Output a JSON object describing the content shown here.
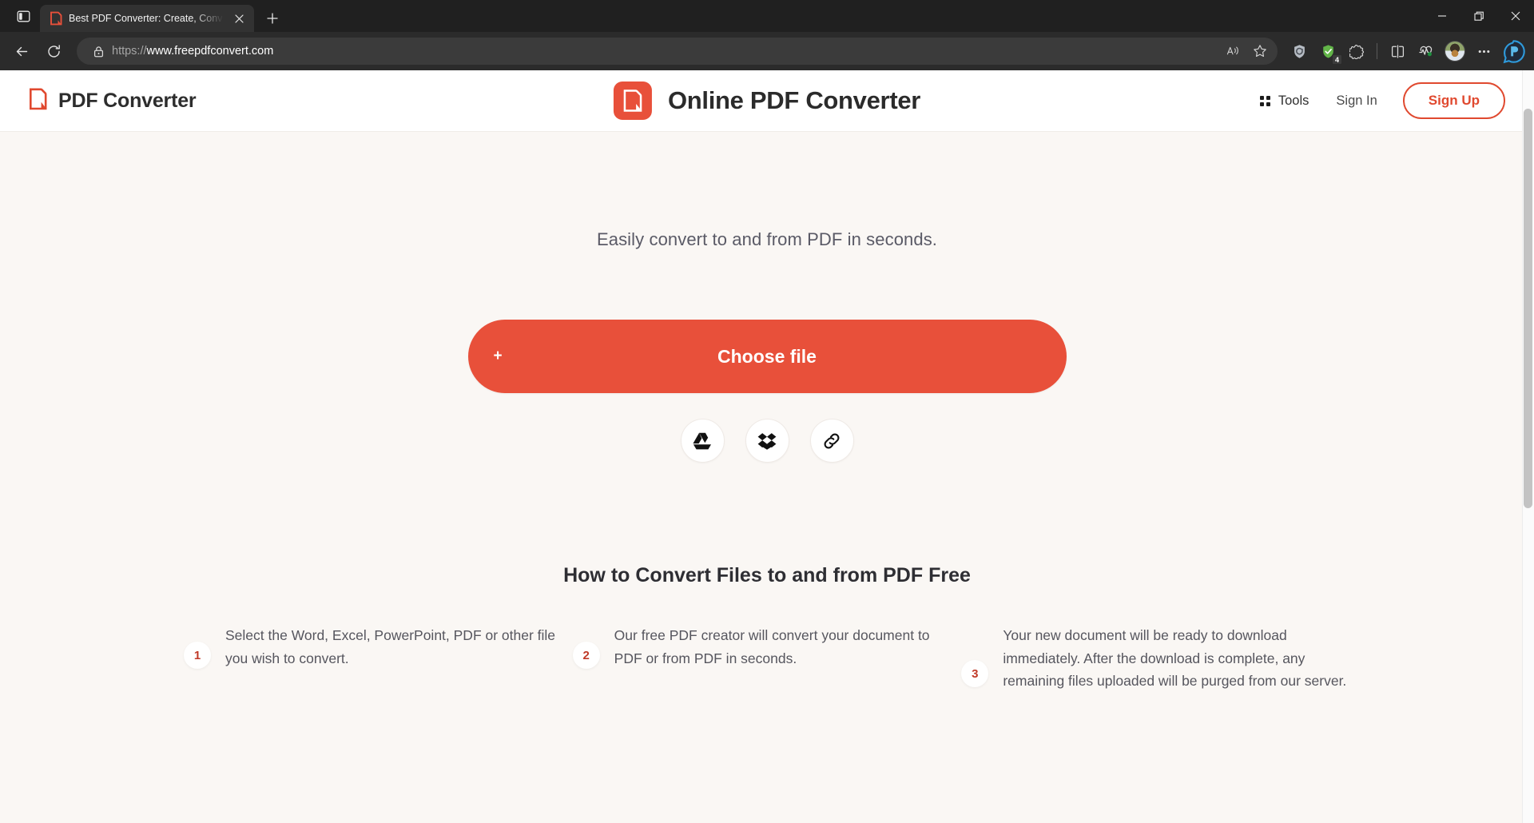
{
  "browser": {
    "tab_sidebar_icon": "split-pane-icon",
    "tab": {
      "favicon": "pdf-converter-favicon",
      "title": "Best PDF Converter: Create, Conv",
      "close_icon": "close-icon"
    },
    "new_tab_label": "+",
    "window_controls": {
      "minimize": "minimize-icon",
      "restore": "restore-icon",
      "close": "close-icon"
    },
    "nav": {
      "back": "back-arrow-icon",
      "reload": "reload-icon"
    },
    "address_bar": {
      "lock_icon": "lock-icon",
      "scheme": "https://",
      "host": "www.freepdfconvert.com",
      "read_aloud_icon": "read-aloud-icon",
      "favorite_icon": "star-icon"
    },
    "toolbar_icons": [
      {
        "name": "shield-icon",
        "badge": ""
      },
      {
        "name": "adguard-icon",
        "badge": "4"
      },
      {
        "name": "extensions-puzzle-icon",
        "badge": ""
      },
      {
        "name": "split-screen-icon",
        "badge": ""
      },
      {
        "name": "browser-essentials-icon",
        "badge": ""
      },
      {
        "name": "profile-avatar",
        "badge": ""
      },
      {
        "name": "settings-more-icon",
        "badge": ""
      },
      {
        "name": "copilot-icon",
        "badge": ""
      }
    ]
  },
  "site": {
    "brand_name": "PDF Converter",
    "center_title": "Online PDF Converter",
    "nav": {
      "tools_label": "Tools",
      "signin_label": "Sign In",
      "signup_label": "Sign Up"
    },
    "hero": {
      "tagline": "Easily convert to and from PDF in seconds.",
      "choose_file_label": "Choose file",
      "plus_symbol": "+",
      "services": [
        {
          "name": "google-drive-icon",
          "label": "Google Drive"
        },
        {
          "name": "dropbox-icon",
          "label": "Dropbox"
        },
        {
          "name": "url-link-icon",
          "label": "From URL"
        }
      ]
    },
    "howto": {
      "title": "How to Convert Files to and from PDF Free",
      "steps": [
        {
          "num": "1",
          "text": "Select the Word, Excel, PowerPoint, PDF or other file you wish to convert."
        },
        {
          "num": "2",
          "text": "Our free PDF creator will convert your document to PDF or from PDF in seconds."
        },
        {
          "num": "3",
          "text": "Your new document will be ready to download immediately. After the download is complete, any remaining files uploaded will be purged from our server."
        }
      ]
    }
  },
  "colors": {
    "accent_red": "#e8503a",
    "signup_red": "#e0492f",
    "page_bg": "#faf7f4",
    "header_bg": "#ffffff",
    "chrome_bg": "#202020"
  }
}
